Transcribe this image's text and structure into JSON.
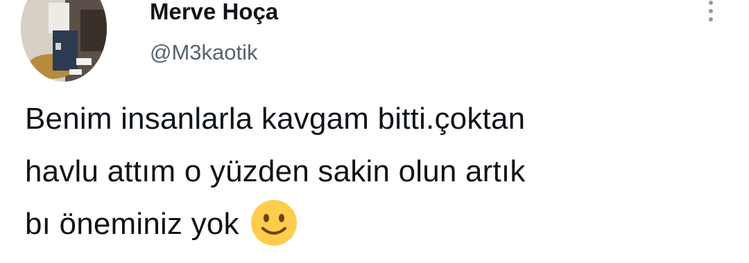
{
  "author": {
    "display_name": "Merve Hoça",
    "handle": "@M3kaotik",
    "avatar_icon": "profile-photo"
  },
  "menu": {
    "icon": "more-vertical-icon"
  },
  "tweet": {
    "lines": [
      "Benim insanlarla kavgam bitti.çoktan",
      "havlu attım o yüzden sakin olun artık",
      "bı öneminiz yok"
    ],
    "emoji": "slightly-smiling-face-emoji"
  },
  "colors": {
    "primary_text": "#0f1419",
    "secondary_text": "#536471",
    "menu_dots": "#8b98a5",
    "emoji_face": "#ffcc4d"
  }
}
